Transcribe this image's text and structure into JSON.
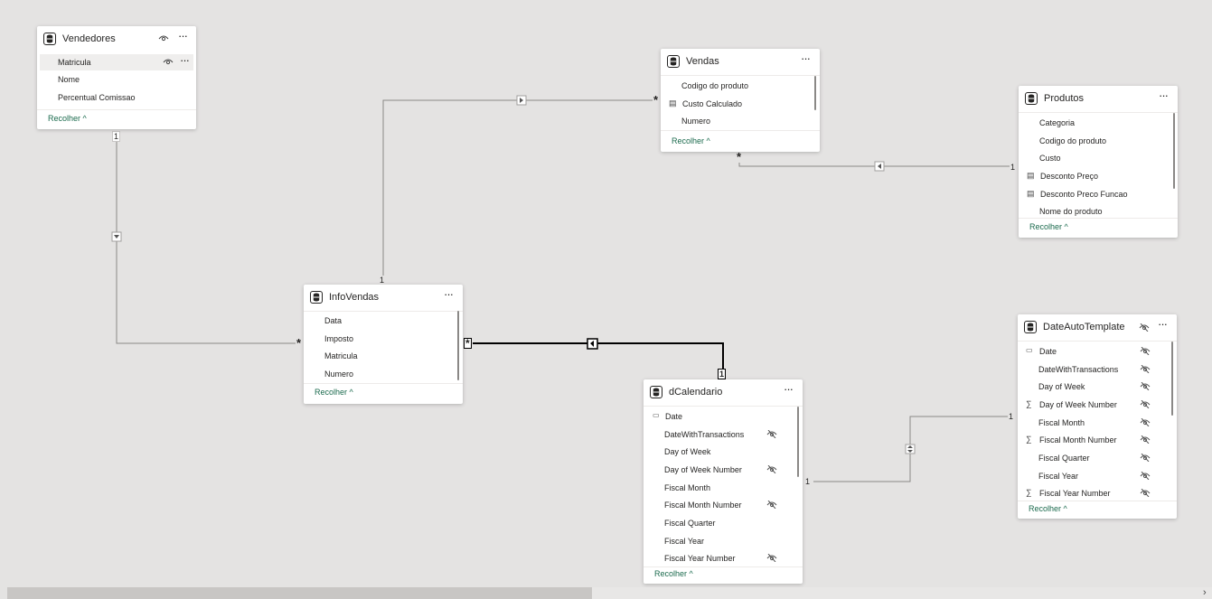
{
  "tables": {
    "vendedores": {
      "title": "Vendedores",
      "fields": [
        "Matricula",
        "Nome",
        "Percentual Comissao"
      ],
      "collapse": "Recolher"
    },
    "vendas": {
      "title": "Vendas",
      "fields": [
        "Codigo do produto",
        "Custo Calculado",
        "Numero"
      ],
      "collapse": "Recolher"
    },
    "produtos": {
      "title": "Produtos",
      "fields": [
        "Categoria",
        "Codigo do produto",
        "Custo",
        "Desconto Preço",
        "Desconto Preco Funcao",
        "Nome do produto"
      ],
      "collapse": "Recolher"
    },
    "infovendas": {
      "title": "InfoVendas",
      "fields": [
        "Data",
        "Imposto",
        "Matricula",
        "Numero"
      ],
      "collapse": "Recolher"
    },
    "dcalendario": {
      "title": "dCalendario",
      "fields": [
        "Date",
        "DateWithTransactions",
        "Day of Week",
        "Day of Week Number",
        "Fiscal Month",
        "Fiscal Month Number",
        "Fiscal Quarter",
        "Fiscal Year",
        "Fiscal Year Number"
      ],
      "collapse": "Recolher"
    },
    "dateautotemplate": {
      "title": "DateAutoTemplate",
      "fields": [
        "Date",
        "DateWithTransactions",
        "Day of Week",
        "Day of Week Number",
        "Fiscal Month",
        "Fiscal Month Number",
        "Fiscal Quarter",
        "Fiscal Year",
        "Fiscal Year Number"
      ],
      "collapse": "Recolher"
    }
  },
  "cardinality": {
    "one": "1",
    "many": "*"
  },
  "icons": {
    "table": "table-icon",
    "visibility": "eye-icon",
    "hidden": "eye-off-icon",
    "more": "more-options-icon",
    "calculated": "calculated-column-icon",
    "sum": "sigma-icon",
    "date": "calendar-field-icon",
    "collapse": "chevron-up-icon"
  },
  "colors": {
    "canvas": "#e4e3e2",
    "card": "#ffffff",
    "link": "#1c6b4e",
    "line": "#8a8886",
    "line_active": "#000000"
  }
}
